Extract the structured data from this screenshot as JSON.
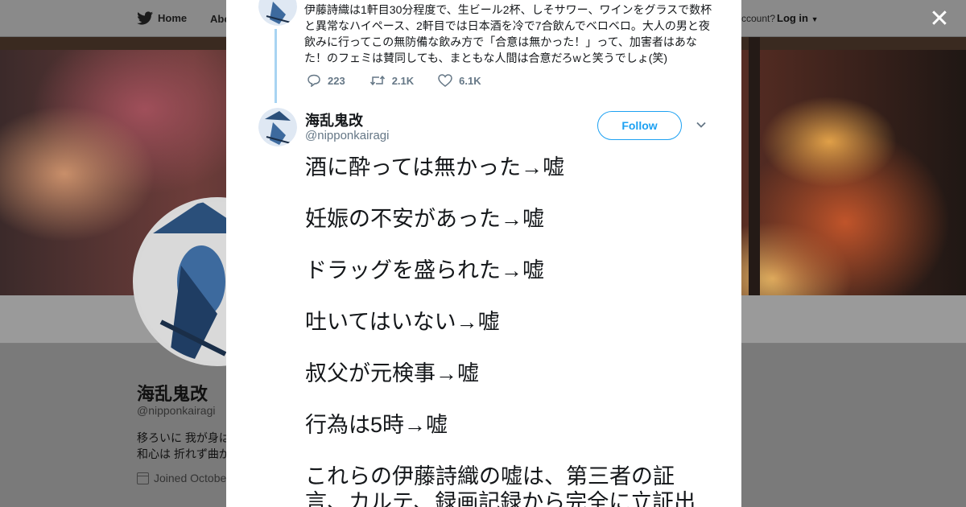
{
  "background": {
    "nav": {
      "home_label": "Home",
      "about_label": "Abo",
      "account_prompt": "ccount?",
      "login_label": "Log in"
    },
    "profile": {
      "name": "海乱鬼改",
      "handle": "@nipponkairagi",
      "bio_line1": "移ろいに 我が身は",
      "bio_line2": "和心は 折れず曲が",
      "joined": "Joined Octobe"
    }
  },
  "modal": {
    "close_icon": "close-icon",
    "previous_tweet": {
      "text": "伊藤詩織は1軒目30分程度で、生ビール2杯、しそサワー、ワインをグラスで数杯と異常なハイペース、2軒目では日本酒を冷で7合飲んでベロベロ。大人の男と夜飲みに行ってこの無防備な飲み方で「合意は無かった！」って、加害者はあなた！のフェミは賛同しても、まともな人間は合意だろwと笑うでしょ(笑)",
      "replies": "223",
      "retweets": "2.1K",
      "likes": "6.1K"
    },
    "tweet": {
      "name": "海乱鬼改",
      "handle": "@nipponkairagi",
      "follow_label": "Follow",
      "lines": [
        "酒に酔っては無かった→嘘",
        "妊娠の不安があった→嘘",
        "ドラッグを盛られた→嘘",
        "吐いてはいない→嘘",
        "叔父が元検事→嘘",
        "行為は5時→嘘",
        "これらの伊藤詩織の嘘は、第三者の証言、カルテ、録画記録から完全に立証出"
      ]
    }
  },
  "colors": {
    "accent": "#1da1f2",
    "thread_line": "#a8d4f2",
    "muted": "#657786"
  }
}
